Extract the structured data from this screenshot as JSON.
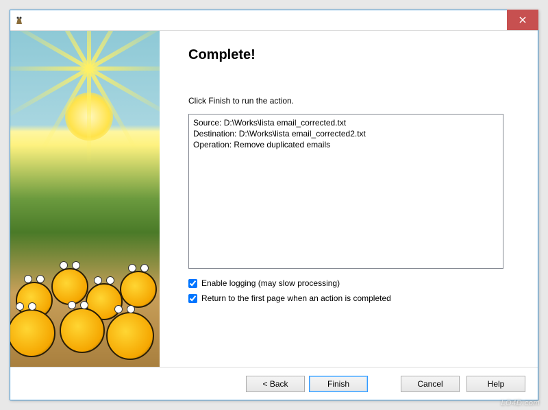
{
  "window": {
    "title": ""
  },
  "wizard": {
    "heading": "Complete!",
    "instruction": "Click Finish to run the action.",
    "summary": {
      "source_label": "Source:",
      "source_path": "D:\\Works\\lista email_corrected.txt",
      "destination_label": "Destination:",
      "destination_path": "D:\\Works\\lista email_corrected2.txt",
      "operation_label": "Operation:",
      "operation_value": "Remove duplicated emails"
    },
    "checkboxes": {
      "enable_logging": {
        "label": "Enable logging (may slow processing)",
        "checked": true
      },
      "return_first": {
        "label": "Return to the first page when an action is completed",
        "checked": true
      }
    }
  },
  "buttons": {
    "back": "< Back",
    "finish": "Finish",
    "cancel": "Cancel",
    "help": "Help"
  },
  "watermark": "LO4D.com"
}
